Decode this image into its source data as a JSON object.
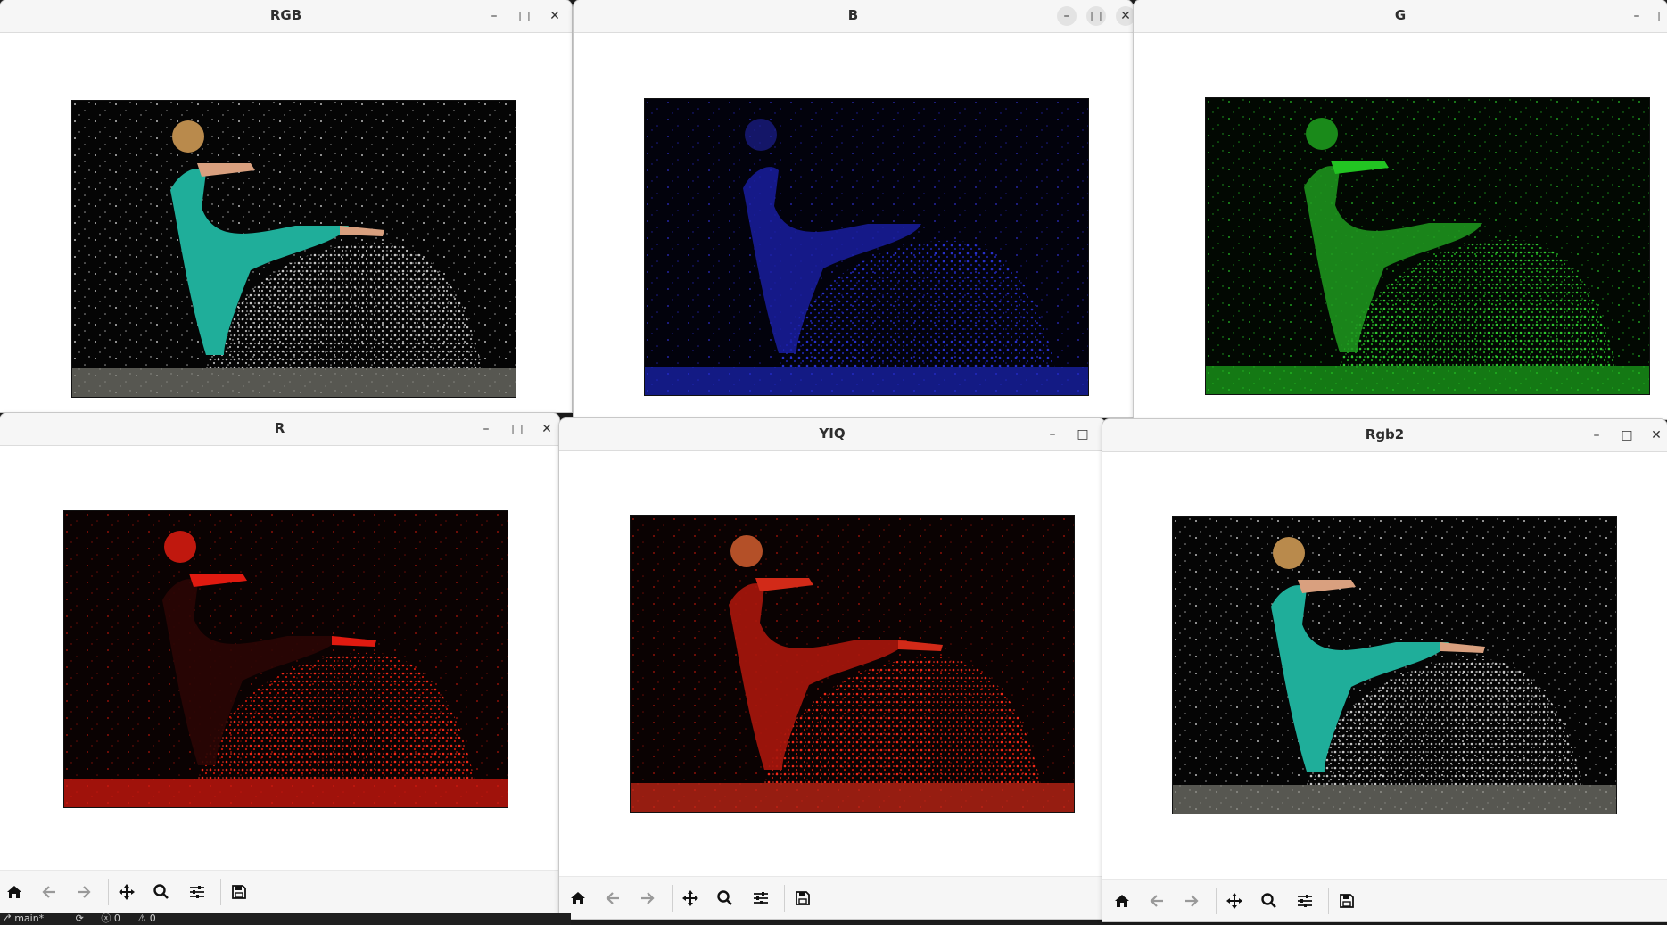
{
  "windows": {
    "rgb": {
      "title": "RGB"
    },
    "b": {
      "title": "B"
    },
    "g": {
      "title": "G"
    },
    "r": {
      "title": "R"
    },
    "yiq": {
      "title": "YIQ"
    },
    "rgb2": {
      "title": "Rgb2"
    }
  },
  "titlebar_controls": {
    "minimize": "–",
    "maximize": "□",
    "close": "✕"
  },
  "toolbar": {
    "icons": [
      "home-icon",
      "back-arrow-icon",
      "forward-arrow-icon",
      "pan-move-icon",
      "zoom-magnifier-icon",
      "configure-subplots-icon",
      "save-icon"
    ]
  },
  "status_bar": {
    "branch": "main*",
    "sync_icon": "sync-icon",
    "errors": "0",
    "warnings": "0"
  },
  "colors": {
    "rgb_dress": "#1fae9a",
    "b_channel": "#1f2bd6",
    "g_channel": "#22c422",
    "r_channel": "#e01a10",
    "yiq_tint": "#d22a18"
  }
}
